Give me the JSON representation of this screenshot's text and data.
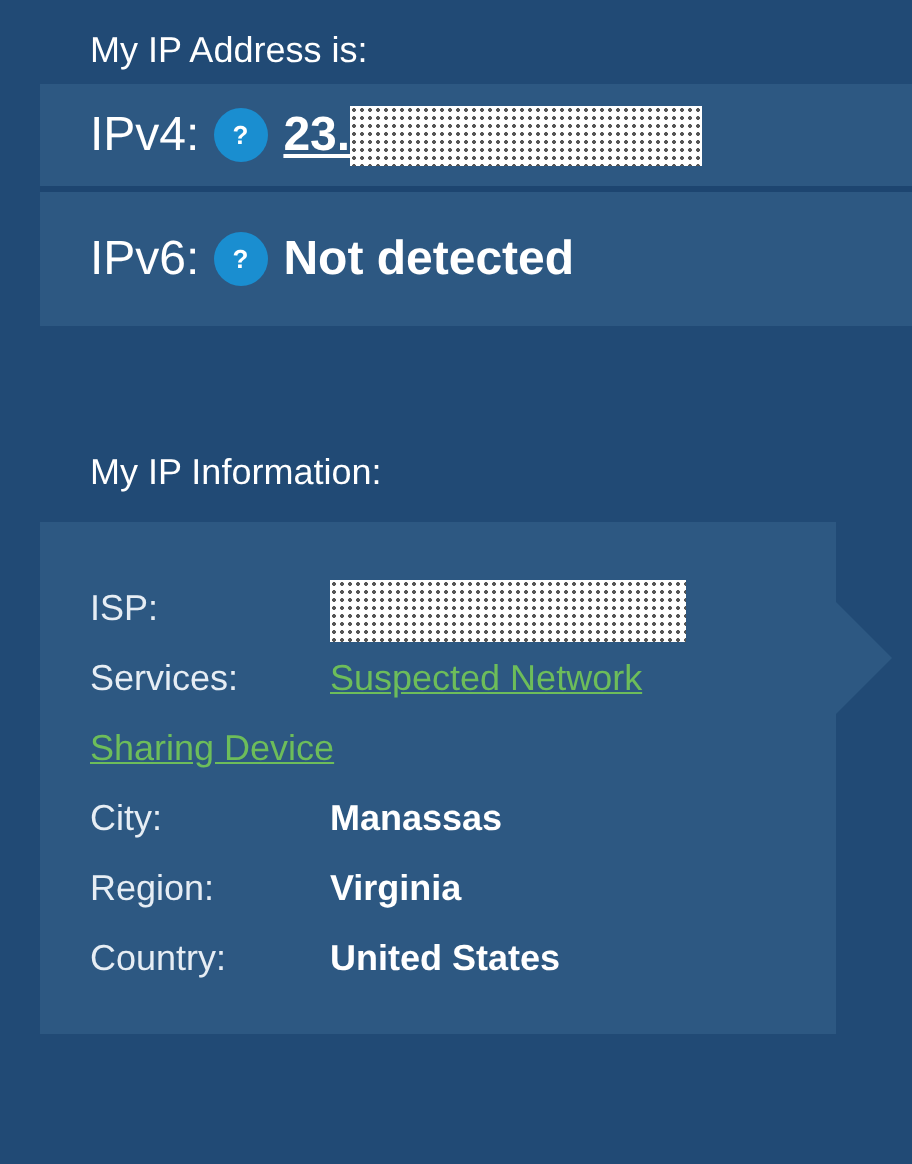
{
  "address_heading": "My IP Address is:",
  "addresses": [
    {
      "label": "IPv4:",
      "help": "?",
      "value": "23.",
      "kind": "link",
      "redacted": true
    },
    {
      "label": "IPv6:",
      "help": "?",
      "value": "Not detected",
      "kind": "text",
      "redacted": false
    }
  ],
  "info_heading": "My IP Information:",
  "info": [
    {
      "label": "ISP:",
      "kind": "text",
      "redacted": true
    },
    {
      "label": "Services:",
      "value_lines": [
        "Suspected Network",
        "Sharing Device"
      ],
      "kind": "link"
    },
    {
      "label": "City:",
      "value": "Manassas",
      "kind": "text"
    },
    {
      "label": "Region:",
      "value": "Virginia",
      "kind": "text"
    },
    {
      "label": "Country:",
      "value": "United States",
      "kind": "text"
    }
  ]
}
